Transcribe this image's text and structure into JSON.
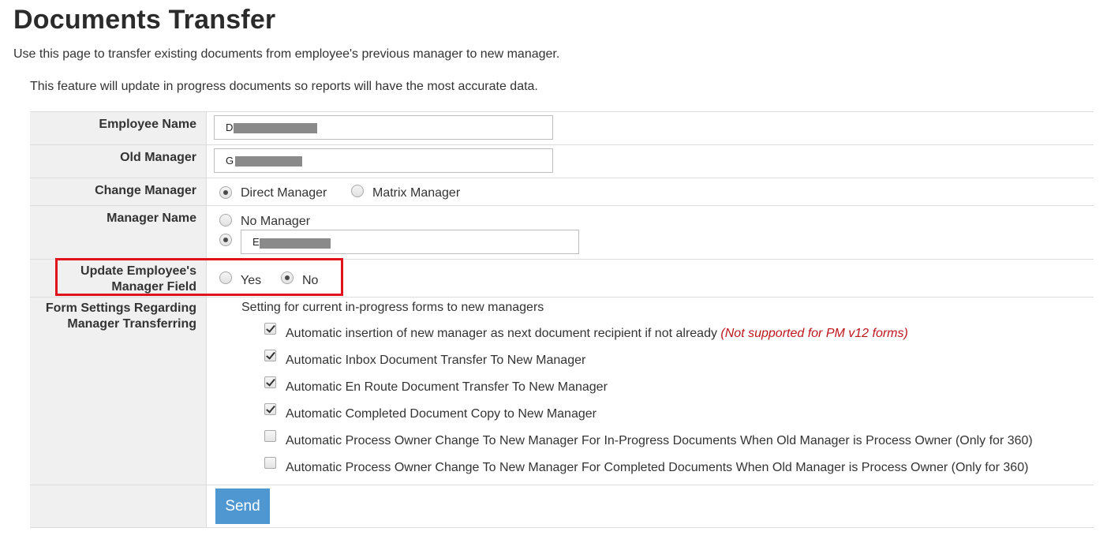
{
  "page": {
    "title": "Documents Transfer",
    "intro": "Use this page to transfer existing documents from employee's previous manager to new manager.",
    "note": "This feature will update in progress documents so reports will have the most accurate data."
  },
  "employee_name": {
    "label": "Employee Name",
    "value": "D"
  },
  "old_manager": {
    "label": "Old Manager",
    "value": "G"
  },
  "change_manager": {
    "label": "Change Manager",
    "options": [
      {
        "label": "Direct Manager",
        "selected": true
      },
      {
        "label": "Matrix Manager",
        "selected": false
      }
    ]
  },
  "manager_name": {
    "label": "Manager Name",
    "no_manager_label": "No Manager",
    "no_manager_selected": false,
    "specific_selected": true,
    "value": "E"
  },
  "update_field": {
    "label_line1": "Update Employee's",
    "label_line2": "Manager Field",
    "options": [
      {
        "label": "Yes",
        "selected": false
      },
      {
        "label": "No",
        "selected": true
      }
    ]
  },
  "form_settings": {
    "label_line1": "Form Settings Regarding",
    "label_line2": "Manager Transferring",
    "heading": "Setting for current in-progress forms to new managers",
    "items": [
      {
        "label": "Automatic insertion of new manager as next document recipient if not already",
        "note": "(Not supported for PM v12 forms)",
        "checked": true
      },
      {
        "label": "Automatic Inbox Document Transfer To New Manager",
        "checked": true
      },
      {
        "label": "Automatic En Route Document Transfer To New Manager",
        "checked": true
      },
      {
        "label": "Automatic Completed Document Copy to New Manager",
        "checked": true
      },
      {
        "label": "Automatic Process Owner Change To New Manager For In-Progress Documents When Old Manager is Process Owner (Only for 360)",
        "checked": false
      },
      {
        "label": "Automatic Process Owner Change To New Manager For Completed Documents When Old Manager is Process Owner (Only for 360)",
        "checked": false
      }
    ]
  },
  "send_button": {
    "label": "Send"
  },
  "colors": {
    "accent": "#4f97d1",
    "highlight": "#e0131c",
    "note": "#c0141c"
  }
}
